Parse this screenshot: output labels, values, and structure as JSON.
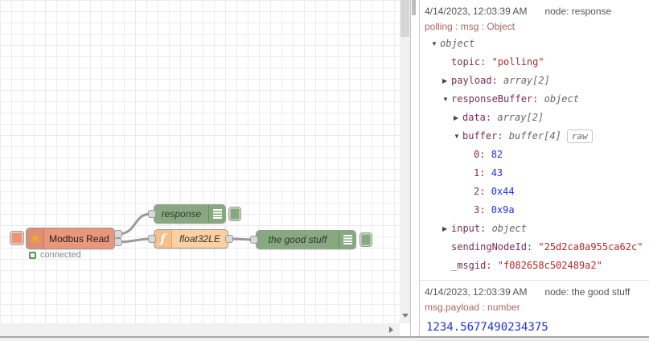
{
  "canvas": {
    "nodes": {
      "modbus": {
        "label": "Modbus Read",
        "color": "#e9967a",
        "icon_color": "#eead1e",
        "icon_glyph": "✱"
      },
      "response": {
        "label": "response",
        "color": "#87a980"
      },
      "func": {
        "label": "float32LE",
        "color": "#fdd0a2",
        "icon_region_color": "#f8bf88",
        "icon_glyph": "ƒ"
      },
      "goodstuff": {
        "label": "the good stuff",
        "color": "#87a980"
      }
    },
    "status": {
      "label": "connected",
      "color": "#3fa03f"
    },
    "wire_color": "#999999"
  },
  "debug": {
    "messages": [
      {
        "timestamp": "4/14/2023, 12:03:39 AM",
        "source": "node: response",
        "topic": "polling : msg : Object",
        "rows": [
          {
            "indent": 0,
            "arrow": "expanded",
            "meta": "object"
          },
          {
            "indent": 1,
            "arrow": null,
            "key": "topic",
            "value": "\"polling\"",
            "vtype": "string"
          },
          {
            "indent": 1,
            "arrow": "collapsed",
            "key": "payload",
            "meta": "array[2]"
          },
          {
            "indent": 1,
            "arrow": "expanded",
            "key": "responseBuffer",
            "meta": "object"
          },
          {
            "indent": 2,
            "arrow": "collapsed",
            "key": "data",
            "meta": "array[2]"
          },
          {
            "indent": 2,
            "arrow": "expanded",
            "key": "buffer",
            "meta": "buffer[4]",
            "raw_button": "raw"
          },
          {
            "indent": 3,
            "arrow": null,
            "key": "0",
            "value": "82",
            "vtype": "number"
          },
          {
            "indent": 3,
            "arrow": null,
            "key": "1",
            "value": "43",
            "vtype": "number"
          },
          {
            "indent": 3,
            "arrow": null,
            "key": "2",
            "value": "0x44",
            "vtype": "number"
          },
          {
            "indent": 3,
            "arrow": null,
            "key": "3",
            "value": "0x9a",
            "vtype": "number"
          },
          {
            "indent": 1,
            "arrow": "collapsed",
            "key": "input",
            "meta": "object"
          },
          {
            "indent": 1,
            "arrow": null,
            "key": "sendingNodeId",
            "value": "\"25d2ca0a955ca62c\"",
            "vtype": "string"
          },
          {
            "indent": 1,
            "arrow": null,
            "key": "_msgid",
            "value": "\"f082658c502489a2\"",
            "vtype": "string"
          }
        ]
      },
      {
        "timestamp": "4/14/2023, 12:03:39 AM",
        "source": "node: the good stuff",
        "topic": "msg.payload : number",
        "payload": "1234.5677490234375"
      }
    ]
  }
}
